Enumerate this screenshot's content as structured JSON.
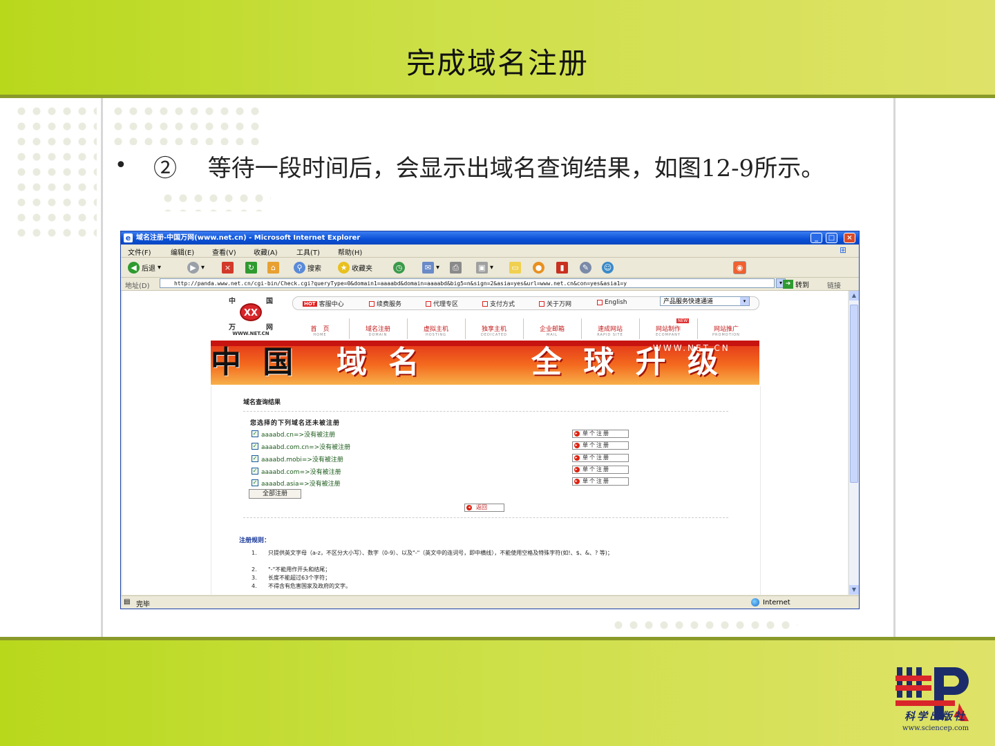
{
  "slide": {
    "title": "完成域名注册",
    "bullet_marker": "•",
    "bullet_text": "② 　等待一段时间后，会显示出域名查询结果，如图12-9所示。",
    "publisher": {
      "name": "科学出版社",
      "url": "www.sciencep.com"
    }
  },
  "colors": {
    "band": "#c8dc2c",
    "accent_red": "#d21a1a",
    "xp_blue": "#0a4fd6"
  },
  "browser": {
    "title": "域名注册-中国万网(www.net.cn) - Microsoft Internet Explorer",
    "window_buttons": {
      "minimize": "_",
      "maximize": "□",
      "close": "×"
    },
    "menu": [
      "文件(F)",
      "编辑(E)",
      "查看(V)",
      "收藏(A)",
      "工具(T)",
      "帮助(H)"
    ],
    "toolbar": {
      "back": "后退",
      "search": "搜索",
      "favorites": "收藏夹"
    },
    "address": {
      "label": "地址(D)",
      "url": "http://panda.www.net.cn/cgi-bin/Check.cgi?queryType=0&domain1=aaaabd&domain=aaaabd&big5=n&sign=2&asia=yes&url=www.net.cn&con=yes&asia1=y",
      "go": "转到",
      "links": "链接"
    },
    "status": {
      "text": "完毕",
      "zone": "Internet"
    }
  },
  "page": {
    "logo": {
      "chars": [
        "中",
        "国",
        "万",
        "网"
      ],
      "mark": "XX",
      "site": "WWW.NET.CN"
    },
    "top_nav": [
      {
        "badge": "HOT",
        "label": "客服中心"
      },
      {
        "label": "续费服务"
      },
      {
        "label": "代理专区"
      },
      {
        "label": "支付方式"
      },
      {
        "label": "关于万网"
      },
      {
        "label": "English"
      }
    ],
    "quick_select": "产品服务快速通道",
    "main_nav": [
      {
        "cn": "首　页",
        "en": "HOME"
      },
      {
        "cn": "域名注册",
        "en": "DOMAIN"
      },
      {
        "cn": "虚拟主机",
        "en": "HOSTING"
      },
      {
        "cn": "独享主机",
        "en": "DEDICATED"
      },
      {
        "cn": "企业邮箱",
        "en": "MAIL"
      },
      {
        "cn": "速成网站",
        "en": "RAPID SITE"
      },
      {
        "cn": "网站制作",
        "en": "ECOMPANY",
        "badge": "NEW"
      },
      {
        "cn": "网站推广",
        "en": "PROMOTION"
      }
    ],
    "banner": {
      "left": "中 国",
      "mid": "域 名",
      "right": "全 球 升 级",
      "url": "WWW.NET.CN"
    },
    "result_title": "域名查询结果",
    "available_heading": "您选择的下列域名还未被注册",
    "domains": [
      {
        "text": "aaaabd.cn=>没有被注册",
        "button": "单个注册"
      },
      {
        "text": "aaaabd.com.cn=>没有被注册",
        "button": "单个注册"
      },
      {
        "text": "aaaabd.mobi=>没有被注册",
        "button": "单个注册"
      },
      {
        "text": "aaaabd.com=>没有被注册",
        "button": "单个注册"
      },
      {
        "text": "aaaabd.asia=>没有被注册",
        "button": "单个注册"
      }
    ],
    "register_all": "全部注册",
    "back": "返回",
    "rules_title": "注册规则：",
    "rules": [
      {
        "num": "1.",
        "text": "只提供英文字母（a-z，不区分大小写）、数字（0-9）、以及\"-\"（英文中的连词号，即中横线），不能使用空格及特殊字符(如!、$、&、? 等)；"
      },
      {
        "num": "2.",
        "text": "\"-\"不能用作开头和结尾；"
      },
      {
        "num": "3.",
        "text": "长度不能超过63个字符；"
      },
      {
        "num": "4.",
        "text": "不得含有危害国家及政府的文字。"
      }
    ]
  }
}
